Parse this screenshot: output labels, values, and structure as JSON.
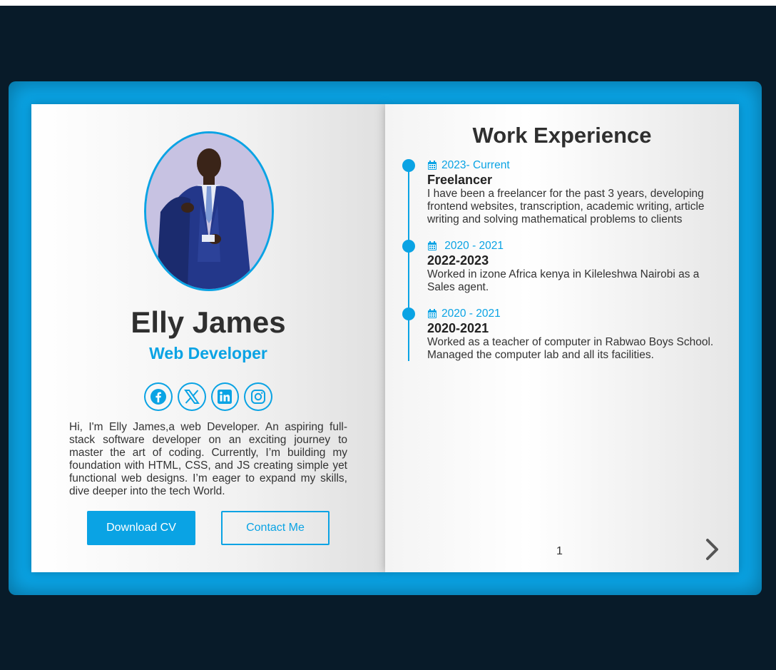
{
  "profile": {
    "name": "Elly James",
    "role": "Web Developer",
    "bio": "Hi, I'm Elly James,a web Developer. An aspiring full-stack software developer on an exciting journey to master the art of coding. Currently, I’m building my foundation with HTML, CSS, and JS creating simple yet functional web designs. I’m eager to expand my skills, dive deeper into the tech World.",
    "photo_icon": "portrait-photo"
  },
  "socials": [
    {
      "icon": "facebook-icon"
    },
    {
      "icon": "x-twitter-icon"
    },
    {
      "icon": "linkedin-icon"
    },
    {
      "icon": "instagram-icon"
    }
  ],
  "buttons": {
    "download_cv": "Download CV",
    "contact_me": "Contact Me"
  },
  "experience": {
    "title": "Work Experience",
    "items": [
      {
        "date": "2023- Current",
        "heading": "Freelancer",
        "description": "I have been a freelancer for the past 3 years, developing frontend websites, transcription, academic writing, article writing and solving mathematical problems to clients"
      },
      {
        "date": " 2020 - 2021",
        "heading": "2022-2023",
        "description": "Worked in izone Africa kenya in Kileleshwa Nairobi as a Sales agent."
      },
      {
        "date": "2020 - 2021",
        "heading": "2020-2021",
        "description": "Worked as a teacher of computer in Rabwao Boys School. Managed the computer lab and all its facilities."
      }
    ]
  },
  "pagination": {
    "page_number": "1",
    "next_icon": "chevron-right-icon"
  },
  "colors": {
    "accent": "#0aa3e4",
    "background": "#081b29",
    "text": "#2f2f2f"
  }
}
